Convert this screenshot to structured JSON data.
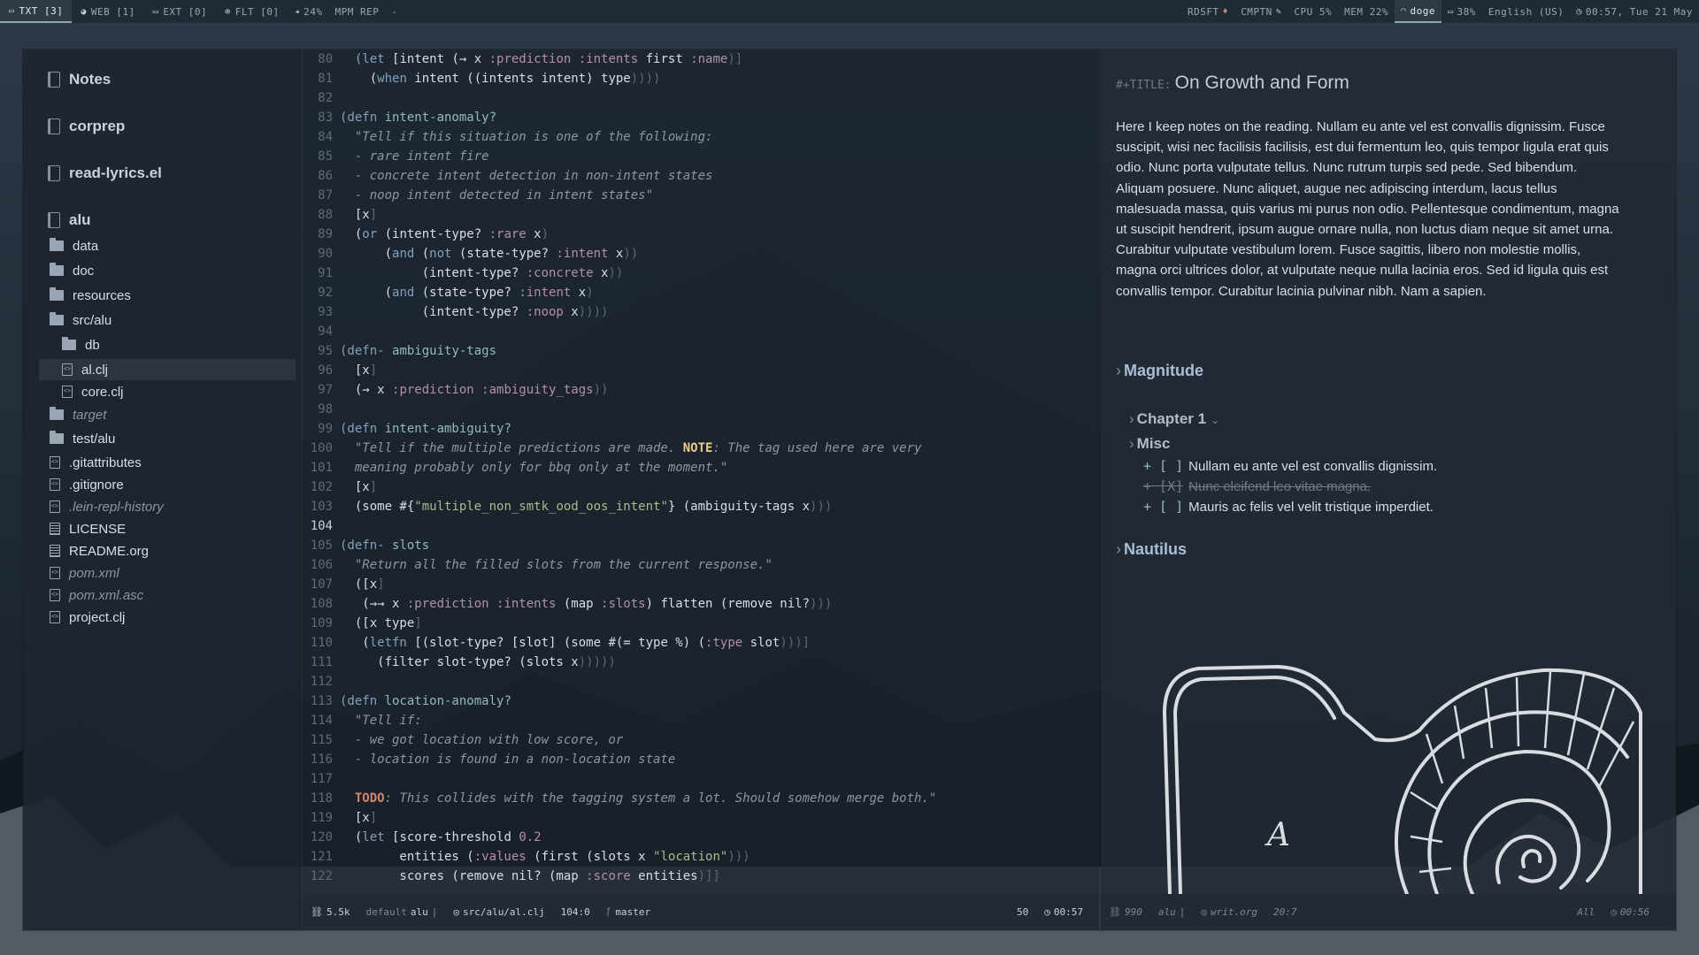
{
  "topbar": {
    "workspaces": [
      {
        "label": "TXT [3]",
        "icon": "monitor-icon",
        "active": true
      },
      {
        "label": "WEB [1]",
        "icon": "globe-icon",
        "active": false
      },
      {
        "label": "EXT [0]",
        "icon": "monitor-icon",
        "active": false
      },
      {
        "label": "FLT [0]",
        "icon": "crosshair-icon",
        "active": false
      }
    ],
    "volume": "24%",
    "media": "MPM REP",
    "media_sep": "-",
    "right": {
      "rdsft": "RDSFT",
      "cmptn": "CMPTN",
      "cpu": "CPU 5%",
      "mem": "MEM 22%",
      "wifi": "doge",
      "battery": "38%",
      "language": "English (US)",
      "clock": "00:57, Tue 21 May"
    }
  },
  "sidebar": {
    "projects": [
      {
        "label": "Notes"
      },
      {
        "label": "corprep"
      },
      {
        "label": "read-lyrics.el"
      },
      {
        "label": "alu"
      }
    ],
    "tree": [
      {
        "label": "data",
        "type": "folder",
        "indent": 0,
        "dim": false
      },
      {
        "label": "doc",
        "type": "folder",
        "indent": 0,
        "dim": false
      },
      {
        "label": "resources",
        "type": "folder",
        "indent": 0,
        "dim": false
      },
      {
        "label": "src/alu",
        "type": "folder",
        "indent": 0,
        "dim": false
      },
      {
        "label": "db",
        "type": "folder",
        "indent": 1,
        "dim": false
      },
      {
        "label": "al.clj",
        "type": "code",
        "indent": 1,
        "dim": false,
        "selected": true
      },
      {
        "label": "core.clj",
        "type": "code",
        "indent": 1,
        "dim": false
      },
      {
        "label": "target",
        "type": "folder",
        "indent": 0,
        "dim": true
      },
      {
        "label": "test/alu",
        "type": "folder",
        "indent": 0,
        "dim": false
      },
      {
        "label": ".gitattributes",
        "type": "code",
        "indent": 0,
        "dim": false
      },
      {
        "label": ".gitignore",
        "type": "code",
        "indent": 0,
        "dim": false
      },
      {
        "label": ".lein-repl-history",
        "type": "code",
        "indent": 0,
        "dim": true
      },
      {
        "label": "LICENSE",
        "type": "doc",
        "indent": 0,
        "dim": false
      },
      {
        "label": "README.org",
        "type": "doc",
        "indent": 0,
        "dim": false
      },
      {
        "label": "pom.xml",
        "type": "code",
        "indent": 0,
        "dim": true
      },
      {
        "label": "pom.xml.asc",
        "type": "code",
        "indent": 0,
        "dim": true
      },
      {
        "label": "project.clj",
        "type": "code",
        "indent": 0,
        "dim": false
      }
    ]
  },
  "editor": {
    "current_line": 104,
    "lines": [
      {
        "n": 80,
        "tokens": [
          [
            "  (let ",
            "kw"
          ],
          [
            "[intent (→ x ",
            ""
          ],
          [
            ":prediction :intents",
            "key"
          ],
          [
            " first ",
            ""
          ],
          [
            ":name",
            "key"
          ],
          [
            ")]",
            "dim"
          ]
        ]
      },
      {
        "n": 81,
        "tokens": [
          [
            "    (",
            ""
          ],
          [
            "when",
            "kw"
          ],
          [
            " intent ((intents intent) type",
            ""
          ],
          [
            "))))",
            "dim"
          ]
        ]
      },
      {
        "n": 82,
        "tokens": []
      },
      {
        "n": 83,
        "tokens": [
          [
            "(defn ",
            "kw"
          ],
          [
            "intent-anomaly?",
            "def"
          ]
        ]
      },
      {
        "n": 84,
        "tokens": [
          [
            "  \"Tell if this situation is one of the following:",
            "doc"
          ]
        ]
      },
      {
        "n": 85,
        "tokens": [
          [
            "  - rare intent fire",
            "doc"
          ]
        ]
      },
      {
        "n": 86,
        "tokens": [
          [
            "  - concrete intent detection in non-intent states",
            "doc"
          ]
        ]
      },
      {
        "n": 87,
        "tokens": [
          [
            "  - noop intent detected in intent states\"",
            "doc"
          ]
        ]
      },
      {
        "n": 88,
        "tokens": [
          [
            "  [x",
            ""
          ],
          [
            "]",
            "dim"
          ]
        ]
      },
      {
        "n": 89,
        "tokens": [
          [
            "  (",
            ""
          ],
          [
            "or",
            "kw"
          ],
          [
            " (intent-type? ",
            ""
          ],
          [
            ":rare",
            "key"
          ],
          [
            " x",
            ""
          ],
          [
            ")",
            "dim"
          ]
        ]
      },
      {
        "n": 90,
        "tokens": [
          [
            "      (",
            ""
          ],
          [
            "and",
            "kw"
          ],
          [
            " (",
            ""
          ],
          [
            "not",
            "kw"
          ],
          [
            " (state-type? ",
            ""
          ],
          [
            ":intent",
            "key"
          ],
          [
            " x",
            ""
          ],
          [
            "))",
            "dim"
          ]
        ]
      },
      {
        "n": 91,
        "tokens": [
          [
            "           (intent-type? ",
            ""
          ],
          [
            ":concrete",
            "key"
          ],
          [
            " x",
            ""
          ],
          [
            "))",
            "dim"
          ]
        ]
      },
      {
        "n": 92,
        "tokens": [
          [
            "      (",
            ""
          ],
          [
            "and",
            "kw"
          ],
          [
            " (state-type? ",
            ""
          ],
          [
            ":intent",
            "key"
          ],
          [
            " x",
            ""
          ],
          [
            ")",
            "dim"
          ]
        ]
      },
      {
        "n": 93,
        "tokens": [
          [
            "           (intent-type? ",
            ""
          ],
          [
            ":noop",
            "key"
          ],
          [
            " x",
            ""
          ],
          [
            "))))",
            "dim"
          ]
        ]
      },
      {
        "n": 94,
        "tokens": []
      },
      {
        "n": 95,
        "tokens": [
          [
            "(defn- ",
            "kw"
          ],
          [
            "ambiguity-tags",
            "def"
          ]
        ]
      },
      {
        "n": 96,
        "tokens": [
          [
            "  [x",
            ""
          ],
          [
            "]",
            "dim"
          ]
        ]
      },
      {
        "n": 97,
        "tokens": [
          [
            "  (→ x ",
            ""
          ],
          [
            ":prediction :ambiguity_tags",
            "key"
          ],
          [
            "))",
            "dim"
          ]
        ]
      },
      {
        "n": 98,
        "tokens": []
      },
      {
        "n": 99,
        "tokens": [
          [
            "(defn ",
            "kw"
          ],
          [
            "intent-ambiguity?",
            "def"
          ]
        ]
      },
      {
        "n": 100,
        "tokens": [
          [
            "  \"Tell if the multiple predictions are made. ",
            "doc"
          ],
          [
            "NOTE",
            "note"
          ],
          [
            ": The tag used here are very",
            "doc"
          ]
        ]
      },
      {
        "n": 101,
        "tokens": [
          [
            "  meaning probably only for bbq only at the moment.\"",
            "doc"
          ]
        ]
      },
      {
        "n": 102,
        "tokens": [
          [
            "  [x",
            ""
          ],
          [
            "]",
            "dim"
          ]
        ]
      },
      {
        "n": 103,
        "tokens": [
          [
            "  (some #{",
            ""
          ],
          [
            "\"multiple_non_smtk_ood_oos_intent\"",
            "str"
          ],
          [
            "} (ambiguity-tags x",
            ""
          ],
          [
            ")))",
            "dim"
          ]
        ]
      },
      {
        "n": 104,
        "tokens": []
      },
      {
        "n": 105,
        "tokens": [
          [
            "(defn- ",
            "kw"
          ],
          [
            "slots",
            "def"
          ]
        ]
      },
      {
        "n": 106,
        "tokens": [
          [
            "  \"Return all the filled slots from the current response.\"",
            "doc"
          ]
        ]
      },
      {
        "n": 107,
        "tokens": [
          [
            "  ([x",
            ""
          ],
          [
            "]",
            "dim"
          ]
        ]
      },
      {
        "n": 108,
        "tokens": [
          [
            "   (→→ x ",
            ""
          ],
          [
            ":prediction :intents",
            "key"
          ],
          [
            " (map ",
            ""
          ],
          [
            ":slots",
            "key"
          ],
          [
            ") flatten (remove nil?",
            ""
          ],
          [
            ")))",
            "dim"
          ]
        ]
      },
      {
        "n": 109,
        "tokens": [
          [
            "  ([x type",
            ""
          ],
          [
            "]",
            "dim"
          ]
        ]
      },
      {
        "n": 110,
        "tokens": [
          [
            "   (",
            ""
          ],
          [
            "letfn",
            "kw"
          ],
          [
            " [(slot-type? [slot] (some #(= type %) (",
            ""
          ],
          [
            ":type",
            "key"
          ],
          [
            " slot",
            ""
          ],
          [
            ")))]",
            "dim"
          ]
        ]
      },
      {
        "n": 111,
        "tokens": [
          [
            "     (filter slot-type? (slots x",
            ""
          ],
          [
            ")))))",
            "dim"
          ]
        ]
      },
      {
        "n": 112,
        "tokens": []
      },
      {
        "n": 113,
        "tokens": [
          [
            "(defn ",
            "kw"
          ],
          [
            "location-anomaly?",
            "def"
          ]
        ]
      },
      {
        "n": 114,
        "tokens": [
          [
            "  \"Tell if:",
            "doc"
          ]
        ]
      },
      {
        "n": 115,
        "tokens": [
          [
            "  - we got location with low score, or",
            "doc"
          ]
        ]
      },
      {
        "n": 116,
        "tokens": [
          [
            "  - location is found in a non-location state",
            "doc"
          ]
        ]
      },
      {
        "n": 117,
        "tokens": []
      },
      {
        "n": 118,
        "tokens": [
          [
            "  ",
            "doc"
          ],
          [
            "TODO",
            "todo"
          ],
          [
            ": This collides with the tagging system a lot. Should somehow merge both.\"",
            "doc"
          ]
        ]
      },
      {
        "n": 119,
        "tokens": [
          [
            "  [x",
            ""
          ],
          [
            "]",
            "dim"
          ]
        ]
      },
      {
        "n": 120,
        "tokens": [
          [
            "  (",
            ""
          ],
          [
            "let",
            "kw"
          ],
          [
            " [score-threshold ",
            ""
          ],
          [
            "0.2",
            "num"
          ]
        ]
      },
      {
        "n": 121,
        "tokens": [
          [
            "        entities (",
            ""
          ],
          [
            ":values",
            "key"
          ],
          [
            " (first (slots x ",
            ""
          ],
          [
            "\"location\"",
            "str"
          ],
          [
            ")))",
            "dim"
          ]
        ]
      },
      {
        "n": 122,
        "tokens": [
          [
            "        scores (remove nil? (map ",
            ""
          ],
          [
            ":score",
            "key"
          ],
          [
            " entities",
            ""
          ],
          [
            ")]]",
            "dim"
          ]
        ]
      }
    ]
  },
  "editor_modeline": {
    "size": "5.5k",
    "workspace": "default",
    "project": "alu",
    "file": "src/alu/al.clj",
    "position": "104:0",
    "branch": "master",
    "count": "50",
    "time": "00:57"
  },
  "org": {
    "title_keyword": "#+TITLE:",
    "title": "On Growth and Form",
    "paragraph": "Here I keep notes on the reading. Nullam eu ante vel est convallis dignissim. Fusce suscipit, wisi nec facilisis facilisis, est dui fermentum leo, quis tempor ligula erat quis odio. Nunc porta vulputate tellus. Nunc rutrum turpis sed pede. Sed bibendum. Aliquam posuere. Nunc aliquet, augue nec adipiscing interdum, lacus tellus malesuada massa, quis varius mi purus non odio. Pellentesque condimentum, magna ut suscipit hendrerit, ipsum augue ornare nulla, non luctus diam neque sit amet urna. Curabitur vulputate vestibulum lorem. Fusce sagittis, libero non molestie mollis, magna orci ultrices dolor, at vulputate neque nulla lacinia eros. Sed id ligula quis est convallis tempor. Curabitur lacinia pulvinar nibh. Nam a sapien.",
    "headings": {
      "magnitude": "Magnitude",
      "chapter1": "Chapter 1",
      "misc": "Misc",
      "nautilus": "Nautilus"
    },
    "checklist": [
      {
        "mark": "+ [ ]",
        "text": "Nullam eu ante vel est convallis dignissim.",
        "done": false
      },
      {
        "mark": "+ [X]",
        "text": "Nunc eleifend leo vitae magna.",
        "done": true
      },
      {
        "mark": "+ [ ]",
        "text": "Mauris ac felis vel velit tristique imperdiet.",
        "done": false
      }
    ],
    "image_letter": "A"
  },
  "org_modeline": {
    "lines": "990",
    "project": "alu",
    "file": "writ.org",
    "position": "20:7",
    "scope": "All",
    "time": "00:56"
  }
}
